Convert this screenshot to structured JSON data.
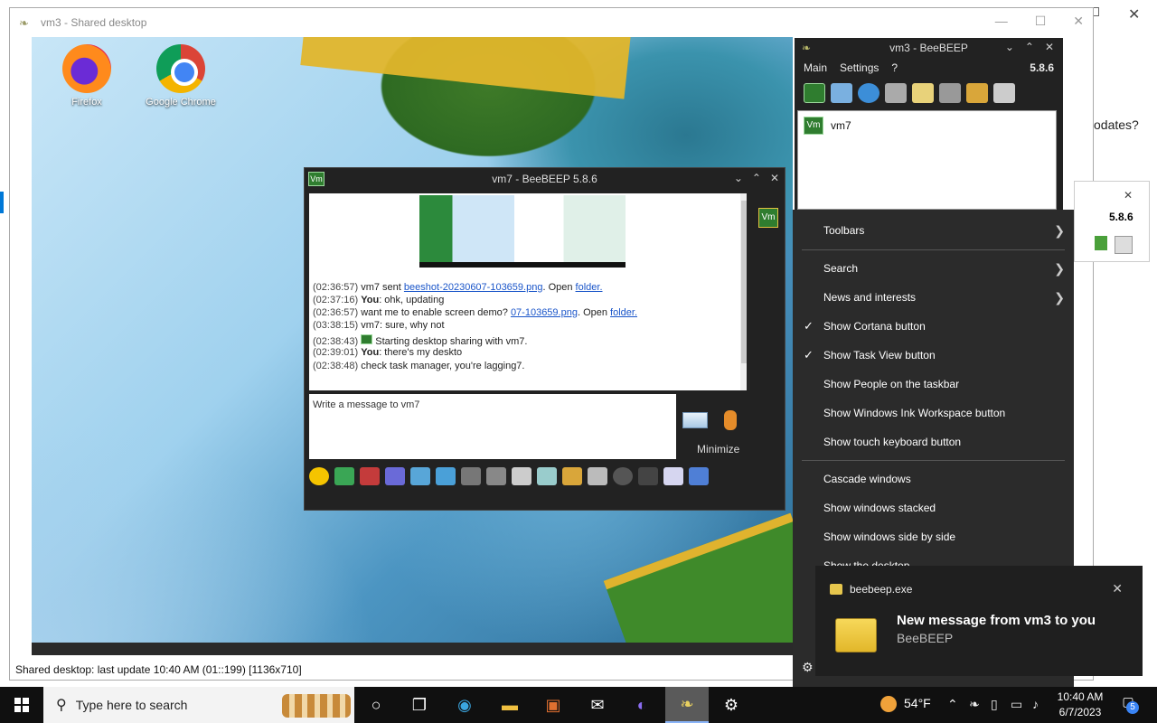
{
  "shared_window": {
    "title": "vm3 - Shared desktop",
    "status": "Shared desktop: last update 10:40 AM (01::199) [1136x710]"
  },
  "background": {
    "updates_text": "odates?"
  },
  "desktop_icons": [
    {
      "label": "Firefox"
    },
    {
      "label": "Google Chrome"
    }
  ],
  "chat_window": {
    "title": "vm7 - BeeBEEP 5.8.6",
    "badge": "Vm",
    "messages": [
      {
        "time": "(02:36:57)",
        "who": "",
        "text": "vm7 sent",
        "link": "beeshot-20230607-103659.png",
        "tail": ". Open",
        "link2": "folder."
      },
      {
        "time": "(02:37:16)",
        "who": "You",
        "text": ": ohk, updating",
        "link": "",
        "tail": "",
        "link2": ""
      },
      {
        "time": "(02:36:57)",
        "who": "",
        "text": "want me to enable screen demo?",
        "link": "07-103659.png",
        "tail": ". Open",
        "link2": "folder."
      },
      {
        "time": "(03:38:15)",
        "who": "",
        "text": "vm7: sure, why not",
        "link": "",
        "tail": "",
        "link2": ""
      },
      {
        "time": "(02:38:43)",
        "who": "",
        "text": "Starting desktop sharing with vm7.",
        "link": "",
        "tail": "",
        "link2": ""
      },
      {
        "time": "(02:39:01)",
        "who": "You",
        "text": ": there's my deskto",
        "link": "",
        "tail": "",
        "link2": ""
      },
      {
        "time": "(02:38:48)",
        "who": "",
        "text": "check task manager, you're lagging7.",
        "link": "",
        "tail": "",
        "link2": ""
      }
    ],
    "input_placeholder": "Write a message to vm7",
    "minimize_label": "Minimize"
  },
  "main_window": {
    "title": "vm3 - BeeBEEP",
    "menu": [
      "Main",
      "Settings",
      "?"
    ],
    "version": "5.8.6",
    "users": [
      {
        "badge": "Vm",
        "name": "vm7"
      }
    ]
  },
  "behind_panel": {
    "version": "5.8.6"
  },
  "context_menu": {
    "items": [
      {
        "label": "Toolbars",
        "check": "",
        "arrow": "❯"
      },
      {
        "label": "Search",
        "check": "",
        "arrow": "❯"
      },
      {
        "label": "News and interests",
        "check": "",
        "arrow": "❯"
      },
      {
        "label": "Show Cortana button",
        "check": "✓",
        "arrow": ""
      },
      {
        "label": "Show Task View button",
        "check": "✓",
        "arrow": ""
      },
      {
        "label": "Show People on the taskbar",
        "check": "",
        "arrow": ""
      },
      {
        "label": "Show Windows Ink Workspace button",
        "check": "",
        "arrow": ""
      },
      {
        "label": "Show touch keyboard button",
        "check": "",
        "arrow": ""
      },
      {
        "label": "Cascade windows",
        "check": "",
        "arrow": ""
      },
      {
        "label": "Show windows stacked",
        "check": "",
        "arrow": ""
      },
      {
        "label": "Show windows side by side",
        "check": "",
        "arrow": ""
      },
      {
        "label": "Show the desktop",
        "check": "",
        "arrow": ""
      }
    ]
  },
  "toast": {
    "app": "beebeep.exe",
    "heading": "New message from vm3 to you",
    "sub": "BeeBEEP"
  },
  "taskbar": {
    "search_placeholder": "Type here to search",
    "temperature": "54°F",
    "time": "10:40 AM",
    "date": "6/7/2023",
    "notification_count": "5"
  },
  "colors": {
    "accent": "#0078d7",
    "taskbar": "#101010",
    "menu_bg": "#2b2b2b",
    "beebeep_green": "#2f7d2f"
  }
}
